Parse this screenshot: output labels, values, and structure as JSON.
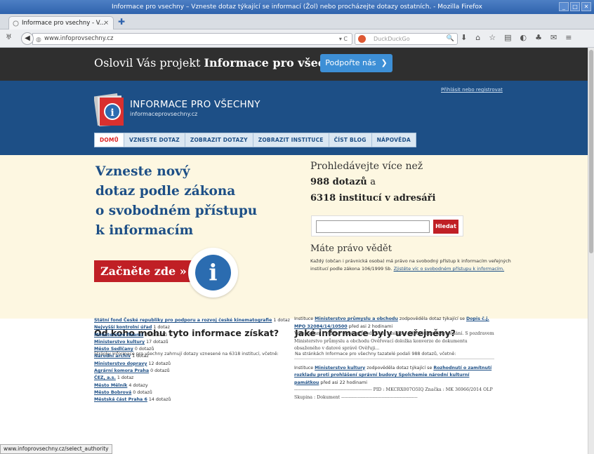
{
  "window": {
    "title": "Informace pro vsechny – Vzneste dotaz týkající se informací (Žol) nebo procházejte dotazy ostatních. - Mozilla Firefox"
  },
  "tab": {
    "label": "Informace pro vsechny - V..."
  },
  "url": "www.infoprovsechny.cz",
  "search_engine_placeholder": "DuckDuckGo",
  "status_url": "www.infoprovsechny.cz/select_authority",
  "promo": {
    "text_plain": "Oslovil Vás projekt",
    "text_bold": "Informace pro všechny?",
    "button": "Podpořte nás"
  },
  "header": {
    "site_title": "INFORMACE PRO VŠECHNY",
    "site_subtitle": "informaceprovsechny.cz",
    "login_link": "Přihlásit nebo registrovat"
  },
  "nav": {
    "items": [
      "DOMŮ",
      "VZNESTE DOTAZ",
      "ZOBRAZIT DOTAZY",
      "ZOBRAZIT INSTITUCE",
      "ČÍST BLOG",
      "NÁPOVĚDA"
    ]
  },
  "hero": {
    "heading_lines": [
      "Vzneste nový",
      "dotaz podle zákona",
      "o svobodném přístupu",
      "k informacím"
    ],
    "cta": "Začněte zde »",
    "search_intro": "Prohledávejte více než",
    "requests_count": "988 dotazů",
    "requests_suffix": "a",
    "authorities_count": "6318 institucí v adresáři",
    "search_button": "Hledat",
    "right_heading": "Máte právo vědět",
    "right_text": "Každý (občan i právnická osoba) má právo na svobodný přístup k informacím veřejných institucí podle zákona 106/1999 Sb.",
    "right_link": "Zjistěte víc o svobodném přístupu k informacím."
  },
  "left_section": {
    "heading": "Od koho mohu tyto informace získat?",
    "intro": "Stránky Informace pro všechny zahrnují dotazy vznesené na 6318 institucí, včetně:",
    "authorities": [
      {
        "name": "Státní fond České republiky pro podporu a rozvoj české kinematografie",
        "count": "1 dotaz"
      },
      {
        "name": "Nejvyšší kontrolní úřad",
        "count": "1 dotaz"
      },
      {
        "name": "Ministerstvo financí",
        "count": "20 dotazů"
      },
      {
        "name": "Ministerstvo kultury",
        "count": "17 dotazů"
      },
      {
        "name": "Město Sedlčany",
        "count": "0 dotazů"
      },
      {
        "name": "Národní archiv",
        "count": "1 dotaz"
      },
      {
        "name": "Ministerstvo dopravy",
        "count": "12 dotazů"
      },
      {
        "name": "Agrární komora Praha",
        "count": "0 dotazů"
      },
      {
        "name": "ČEZ, a.s.",
        "count": "1 dotaz"
      },
      {
        "name": "Město Mělník",
        "count": "4 dotazy"
      },
      {
        "name": "Město Bobrová",
        "count": "0 dotazů"
      },
      {
        "name": "Městská část Praha 6",
        "count": "14 dotazů"
      }
    ]
  },
  "right_section": {
    "heading": "Jaké informace byly uveřejněny?",
    "intro": "Na stránkách Informace pro všechny tazatelé podali 988 dotazů, včetně:",
    "item1": {
      "prefix": "Instituce",
      "authority": "Ministerstvo průmyslu a obchodu",
      "middle": "zodpověděla dotaz týkající se",
      "request": "Dopis č.j. MPO 32084/14/10500",
      "time": "před asi 2 hodinami",
      "excerpt": "Vážená paní / vážený pane, průvodu Vám zasíláme odpověď na Vaše podání. S pozdravem Ministerstvo průmyslu a obchodu Ověřovací doložka konverze do dokumentu obsaženého v datové správě Ověřuji..."
    },
    "item2": {
      "prefix": "Instituce",
      "authority": "Ministerstvo kultury",
      "middle": "zodpověděla dotaz týkající se",
      "request": "Rozhodnutí o zamítnutí rozkladu proti prohlášení správní budovy Spolchemie národní kulturní památkou",
      "time": "před asi 22 hodinami",
      "excerpt": "---------------------------------------------------- PID : MKCRX007O5IQ Značka : MK 36966/2014 OLP Skupina : Dokument ---------------------------------------------------"
    }
  }
}
